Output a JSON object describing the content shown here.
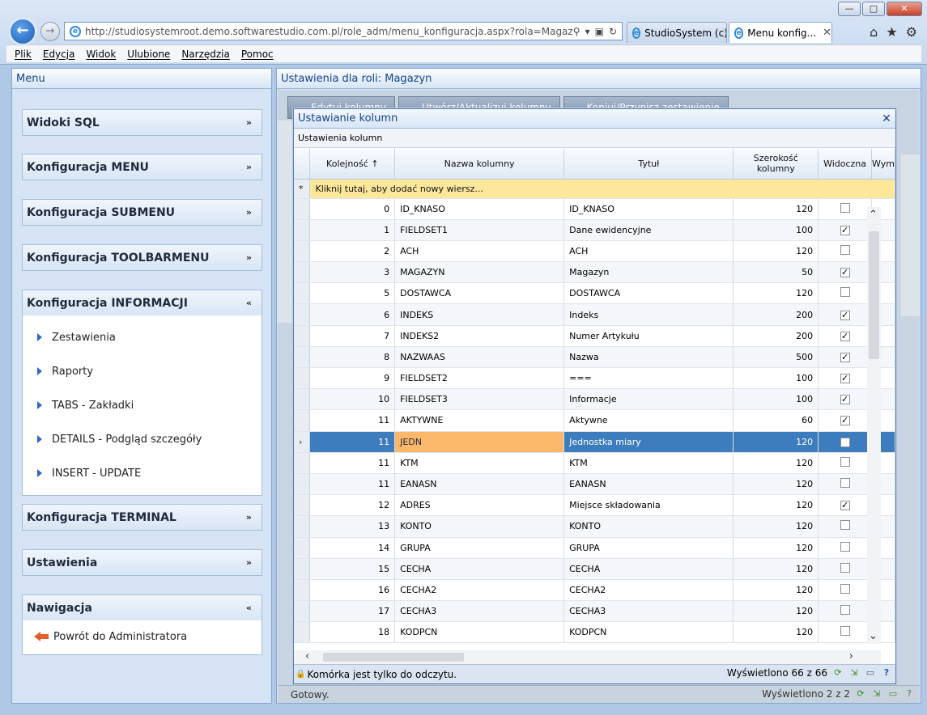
{
  "browser": {
    "address": "http://studiosystemroot.demo.softwarestudio.com.pl/role_adm/menu_konfiguracja.aspx?rola=Magazyn",
    "tabs": [
      {
        "label": "StudioSystem (c)..."
      },
      {
        "label": "Menu konfig..."
      }
    ],
    "menu": [
      "Plik",
      "Edycja",
      "Widok",
      "Ulubione",
      "Narzędzia",
      "Pomoc"
    ]
  },
  "left_panel": {
    "title": "Menu",
    "sections": [
      {
        "label": "Widoki SQL"
      },
      {
        "label": "Konfiguracja MENU"
      },
      {
        "label": "Konfiguracja SUBMENU"
      },
      {
        "label": "Konfiguracja TOOLBARMENU"
      },
      {
        "label": "Konfiguracja INFORMACJI",
        "items": [
          "Zestawienia",
          "Raporty",
          "TABS - Zakładki",
          "DETAILS - Podgląd szczegóły",
          "INSERT - UPDATE"
        ]
      },
      {
        "label": "Konfiguracja TERMINAL"
      },
      {
        "label": "Ustawienia"
      },
      {
        "label": "Nawigacja",
        "items": [
          "Powrót do Administratora"
        ]
      }
    ]
  },
  "right_panel": {
    "title": "Ustawienia dla roli: Magazyn",
    "toolbar": [
      "Edytuj kolumny",
      "Utwórz/Aktualizuj kolumny",
      "Kopiuj/Przypisz zestawienie"
    ],
    "status_left": "Gotowy.",
    "status_right": "Wyświetlono 2 z 2"
  },
  "modal": {
    "title": "Ustawianie kolumn",
    "subtitle": "Ustawienia kolumn",
    "columns": [
      "Kolejność",
      "Nazwa kolumny",
      "Tytuł",
      "Szerokość kolumny",
      "Widoczna",
      "Wym"
    ],
    "add_row_text": "Kliknij tutaj, aby dodać nowy wiersz...",
    "rows": [
      {
        "order": "0",
        "name": "ID_KNASO",
        "title": "ID_KNASO",
        "width": "120",
        "visible": false
      },
      {
        "order": "1",
        "name": "FIELDSET1",
        "title": "Dane ewidencyjne",
        "width": "100",
        "visible": true
      },
      {
        "order": "2",
        "name": "ACH",
        "title": "ACH",
        "width": "120",
        "visible": false
      },
      {
        "order": "3",
        "name": "MAGAZYN",
        "title": "Magazyn",
        "width": "50",
        "visible": true
      },
      {
        "order": "5",
        "name": "DOSTAWCA",
        "title": "DOSTAWCA",
        "width": "120",
        "visible": false
      },
      {
        "order": "6",
        "name": "INDEKS",
        "title": "Indeks",
        "width": "200",
        "visible": true
      },
      {
        "order": "7",
        "name": "INDEKS2",
        "title": "Numer Artykułu",
        "width": "200",
        "visible": true
      },
      {
        "order": "8",
        "name": "NAZWAAS",
        "title": "Nazwa",
        "width": "500",
        "visible": true
      },
      {
        "order": "9",
        "name": "FIELDSET2",
        "title": "===",
        "width": "100",
        "visible": true
      },
      {
        "order": "10",
        "name": "FIELDSET3",
        "title": "Informacje",
        "width": "100",
        "visible": true
      },
      {
        "order": "11",
        "name": "AKTYWNE",
        "title": "Aktywne",
        "width": "60",
        "visible": true
      },
      {
        "order": "11",
        "name": "JEDN",
        "title": "Jednostka miary",
        "width": "120",
        "visible": true,
        "current": true
      },
      {
        "order": "11",
        "name": "KTM",
        "title": "KTM",
        "width": "120",
        "visible": false
      },
      {
        "order": "11",
        "name": "EANASN",
        "title": "EANASN",
        "width": "120",
        "visible": false
      },
      {
        "order": "12",
        "name": "ADRES",
        "title": "Miejsce składowania",
        "width": "120",
        "visible": true
      },
      {
        "order": "13",
        "name": "KONTO",
        "title": "KONTO",
        "width": "120",
        "visible": false
      },
      {
        "order": "14",
        "name": "GRUPA",
        "title": "GRUPA",
        "width": "120",
        "visible": false
      },
      {
        "order": "15",
        "name": "CECHA",
        "title": "CECHA",
        "width": "120",
        "visible": false
      },
      {
        "order": "16",
        "name": "CECHA2",
        "title": "CECHA2",
        "width": "120",
        "visible": false
      },
      {
        "order": "17",
        "name": "CECHA3",
        "title": "CECHA3",
        "width": "120",
        "visible": false
      },
      {
        "order": "18",
        "name": "KODPCN",
        "title": "KODPCN",
        "width": "120",
        "visible": false
      }
    ],
    "status_left": "Komórka jest tylko do odczytu.",
    "status_right": "Wyświetlono 66 z 66"
  }
}
